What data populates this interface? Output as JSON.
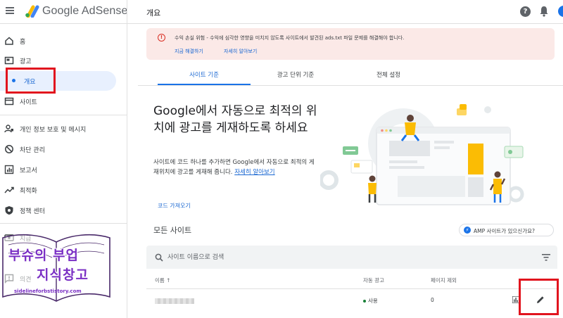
{
  "header": {
    "brand": "Google AdSense",
    "page_title": "개요"
  },
  "sidebar": {
    "items": [
      {
        "label": "홈",
        "icon": "home-icon"
      },
      {
        "label": "광고",
        "icon": "ads-icon"
      },
      {
        "label": "개요",
        "icon": "dot-icon",
        "active": true
      },
      {
        "label": "사이트",
        "icon": "sites-icon"
      },
      {
        "label": "개인 정보 보호 및 메시지",
        "icon": "privacy-icon"
      },
      {
        "label": "차단 관리",
        "icon": "block-icon"
      },
      {
        "label": "보고서",
        "icon": "reports-icon"
      },
      {
        "label": "최적화",
        "icon": "optimize-icon"
      },
      {
        "label": "정책 센터",
        "icon": "policy-icon"
      },
      {
        "label": "지급",
        "icon": "payments-icon"
      },
      {
        "label": "의견",
        "icon": "feedback-icon"
      }
    ]
  },
  "banner": {
    "message": "수익 손실 위험 - 수익에 심각한 영향을 미치지 않도록 사이트에서 발견된 ads.txt 파일 문제를 해결해야 합니다.",
    "fix_link": "지금 해결하기",
    "learn_link": "자세히 알아보기",
    "color": "#fbe9e7"
  },
  "tabs": [
    {
      "label": "사이트 기준",
      "active": true
    },
    {
      "label": "광고 단위 기준"
    },
    {
      "label": "전체 설정"
    }
  ],
  "promo": {
    "heading": "Google에서 자동으로 최적의 위치에 광고를 게재하도록 하세요",
    "body": "사이트에 코드 하나를 추가하면 Google에서 자동으로 최적의 게재위치에 광고를 게재해 줍니다.",
    "learn_more": "자세히 알아보기",
    "get_code": "코드 가져오기"
  },
  "sites": {
    "title": "모든 사이트",
    "amp_chip": "AMP 사이트가 있으신가요?",
    "search_placeholder": "사이트 이름으로 검색",
    "columns": [
      "이름 ↑",
      "자동 광고",
      "페이지 제외"
    ],
    "rows": [
      {
        "auto_ads": "사용",
        "page_exclusions": "0"
      }
    ]
  },
  "watermark": {
    "line1": "부슈의 부업",
    "line2": "지식창고",
    "url": "sidelineforbstistory.com"
  },
  "colors": {
    "accent": "#1a73e8",
    "highlight_box": "#e1141e",
    "warning": "#d93025",
    "status_on": "#188038"
  }
}
